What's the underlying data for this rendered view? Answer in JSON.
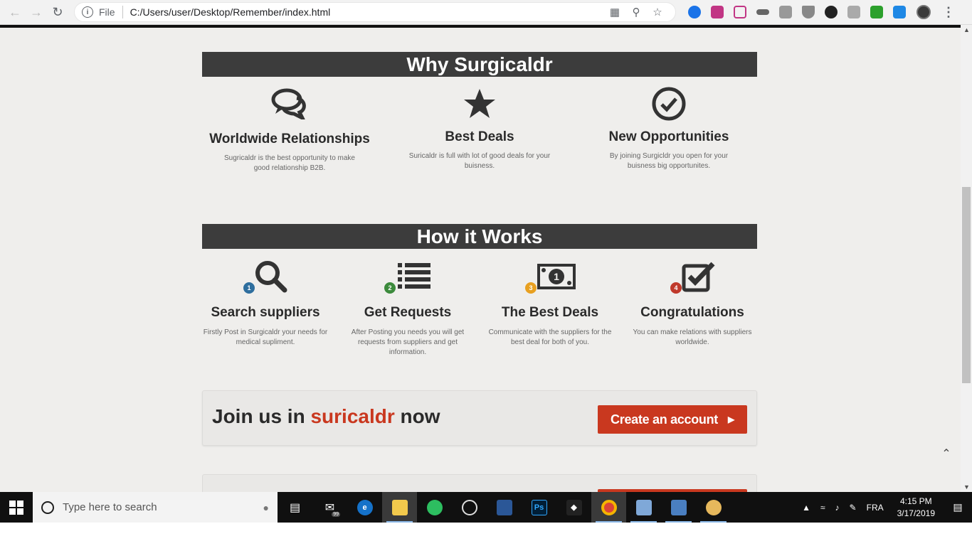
{
  "browser": {
    "scheme_label": "File",
    "url": "C:/Users/user/Desktop/Remember/index.html"
  },
  "why": {
    "heading": "Why Surgicaldr",
    "items": [
      {
        "icon": "comments-icon",
        "title": "Worldwide Relationships",
        "desc": "Sugricaldr is the best opportunity to make good relationship B2B."
      },
      {
        "icon": "star-icon",
        "title": "Best Deals",
        "desc": "Suricaldr is full with lot of good deals for your buisness."
      },
      {
        "icon": "check-circle-icon",
        "title": "New Opportunities",
        "desc": "By joining Surgicldr you open for your buisness big opportunites."
      }
    ]
  },
  "how": {
    "heading": "How it Works",
    "steps": [
      {
        "number": "1",
        "color": "#2e6e9e",
        "icon": "search-icon",
        "title": "Search suppliers",
        "desc": "Firstly Post in Surgicaldr your needs for medical supliment."
      },
      {
        "number": "2",
        "color": "#3c8a3c",
        "icon": "list-icon",
        "title": "Get Requests",
        "desc": "After Posting you needs you will get requests from suppliers and get information."
      },
      {
        "number": "3",
        "color": "#e8a020",
        "icon": "money-icon",
        "title": "The Best Deals",
        "desc": "Communicate with the suppliers for the best deal for both of you."
      },
      {
        "number": "4",
        "color": "#c0392b",
        "icon": "check-square-icon",
        "title": "Congratulations",
        "desc": "You can make relations with suppliers worldwide."
      }
    ]
  },
  "join": {
    "prefix": "Join us in ",
    "brand": "suricaldr",
    "suffix": " now",
    "button_label": "Create an account",
    "accent_color": "#c9381f"
  },
  "taskbar": {
    "search_placeholder": "Type here to search",
    "language": "FRA",
    "time": "4:15 PM",
    "date": "3/17/2019",
    "mail_badge": "99"
  }
}
